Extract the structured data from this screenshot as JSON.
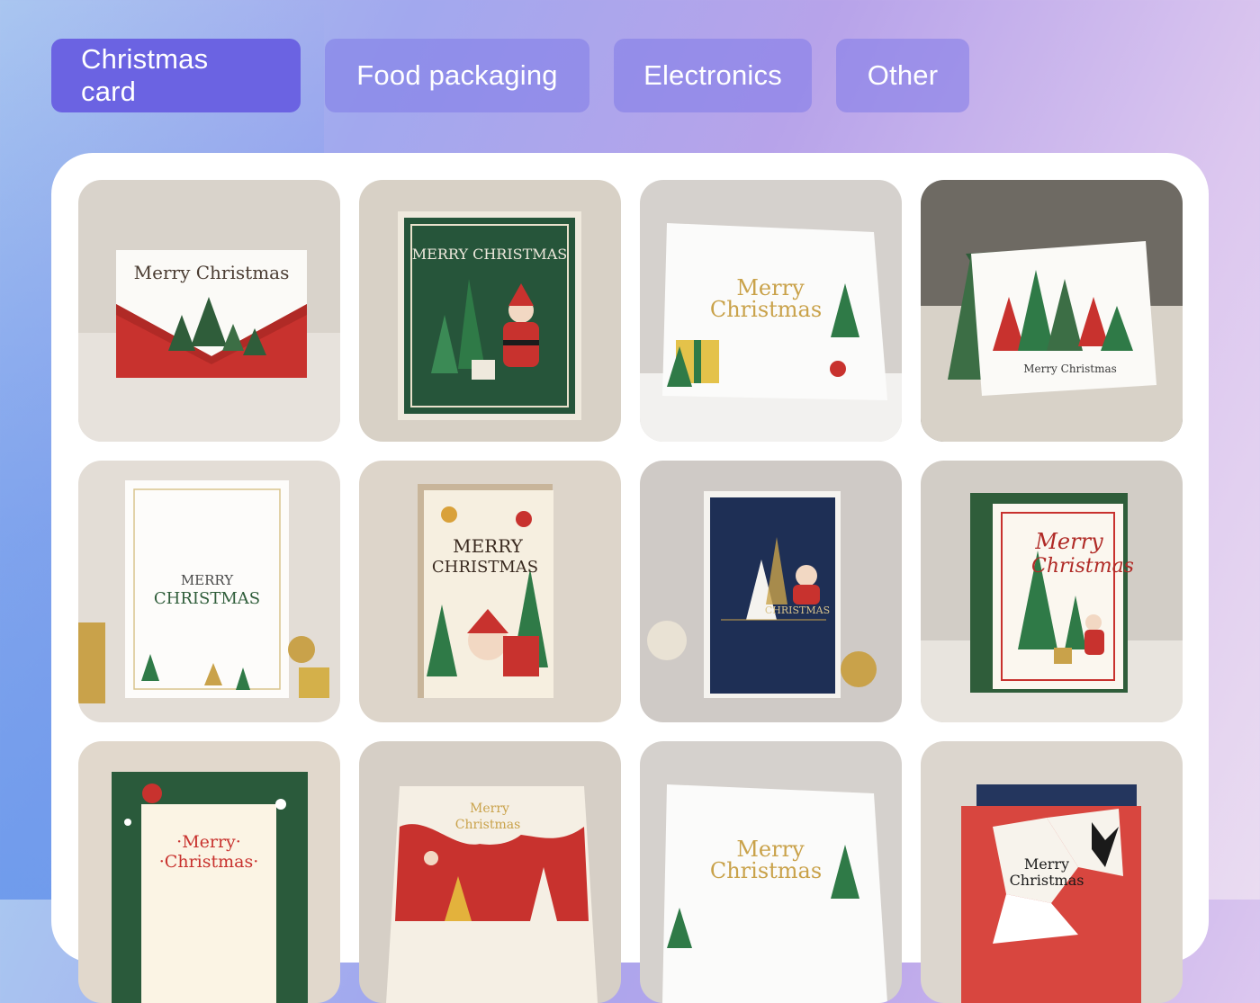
{
  "tabs": [
    {
      "label": "Christmas card",
      "active": true
    },
    {
      "label": "Food packaging",
      "active": false
    },
    {
      "label": "Electronics",
      "active": false
    },
    {
      "label": "Other",
      "active": false
    }
  ],
  "cards": [
    {
      "line1": "Merry Christmas",
      "line2": ""
    },
    {
      "line1": "MERRY CHRISTMAS",
      "line2": ""
    },
    {
      "line1": "Merry",
      "line2": "Christmas"
    },
    {
      "line1": "Merry Christmas",
      "line2": ""
    },
    {
      "line1": "MERRY",
      "line2": "CHRISTMAS"
    },
    {
      "line1": "MERRY",
      "line2": "CHRISTMAS"
    },
    {
      "line1": "CHRISTMAS",
      "line2": ""
    },
    {
      "line1": "Merry",
      "line2": "Christmas"
    },
    {
      "line1": "·Merry·",
      "line2": "·Christmas·"
    },
    {
      "line1": "Merry",
      "line2": "Christmas"
    },
    {
      "line1": "Merry",
      "line2": "Christmas"
    },
    {
      "line1": "Merry",
      "line2": "Christmas"
    }
  ],
  "colors": {
    "accent": "#6b63e2",
    "red": "#c8322e",
    "green": "#2f5d3a",
    "navy": "#1e2f55",
    "gold": "#c9a24a"
  }
}
